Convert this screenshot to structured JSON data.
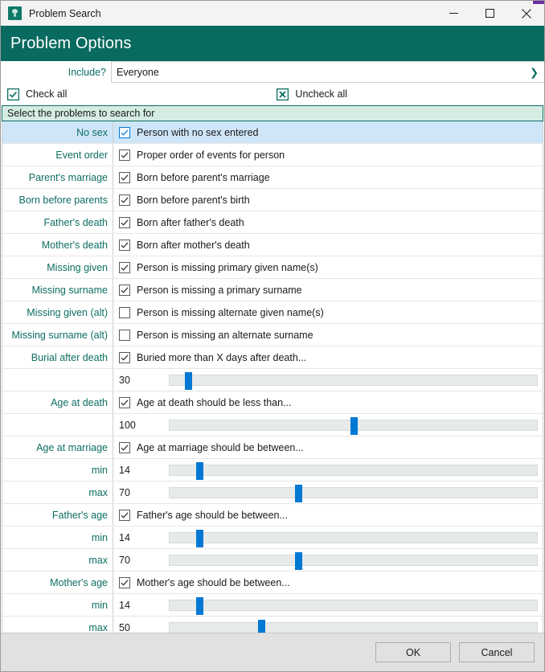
{
  "window": {
    "title": "Problem Search",
    "icon": "tree-icon",
    "controls": {
      "minimize": "minimize-icon",
      "maximize": "maximize-icon",
      "close": "close-icon"
    }
  },
  "banner": {
    "title": "Problem Options",
    "color": "#096a5f"
  },
  "include": {
    "label": "Include?",
    "value": "Everyone",
    "chevron": "chevron-right-icon"
  },
  "bulk": {
    "check_all": "Check all",
    "uncheck_all": "Uncheck all",
    "check_icon": "checkbox-checked-icon",
    "uncheck_icon": "checkbox-x-icon"
  },
  "section": {
    "header": "Select the problems to search for"
  },
  "accent": {
    "teal": "#0d6e62",
    "selection": "#cfe6f9",
    "thumb": "#0078d4"
  },
  "rows": [
    {
      "kind": "check",
      "label": "No sex",
      "text": "Person with no sex entered",
      "checked": true,
      "selected": true
    },
    {
      "kind": "check",
      "label": "Event order",
      "text": "Proper order of events for person",
      "checked": true,
      "selected": false
    },
    {
      "kind": "check",
      "label": "Parent's marriage",
      "text": "Born before parent's marriage",
      "checked": true,
      "selected": false
    },
    {
      "kind": "check",
      "label": "Born before parents",
      "text": "Born before parent's birth",
      "checked": true,
      "selected": false
    },
    {
      "kind": "check",
      "label": "Father's death",
      "text": "Born after father's death",
      "checked": true,
      "selected": false
    },
    {
      "kind": "check",
      "label": "Mother's death",
      "text": "Born after mother's death",
      "checked": true,
      "selected": false
    },
    {
      "kind": "check",
      "label": "Missing given",
      "text": "Person is missing primary given name(s)",
      "checked": true,
      "selected": false
    },
    {
      "kind": "check",
      "label": "Missing surname",
      "text": "Person is missing a primary surname",
      "checked": true,
      "selected": false
    },
    {
      "kind": "check",
      "label": "Missing given (alt)",
      "text": "Person is missing alternate given name(s)",
      "checked": false,
      "selected": false
    },
    {
      "kind": "check",
      "label": "Missing surname (alt)",
      "text": "Person is missing an alternate surname",
      "checked": false,
      "selected": false
    },
    {
      "kind": "check",
      "label": "Burial after death",
      "text": "Buried more than X days after death...",
      "checked": true,
      "selected": false
    },
    {
      "kind": "slider",
      "label": "",
      "value": "30",
      "pct": 5
    },
    {
      "kind": "check",
      "label": "Age at death",
      "text": "Age at death should be less than...",
      "checked": true,
      "selected": false
    },
    {
      "kind": "slider",
      "label": "",
      "value": "100",
      "pct": 50
    },
    {
      "kind": "check",
      "label": "Age at marriage",
      "text": "Age at marriage should be between...",
      "checked": true,
      "selected": false
    },
    {
      "kind": "slider",
      "label": "min",
      "value": "14",
      "pct": 8
    },
    {
      "kind": "slider",
      "label": "max",
      "value": "70",
      "pct": 35
    },
    {
      "kind": "check",
      "label": "Father's age",
      "text": "Father's age should be between...",
      "checked": true,
      "selected": false
    },
    {
      "kind": "slider",
      "label": "min",
      "value": "14",
      "pct": 8
    },
    {
      "kind": "slider",
      "label": "max",
      "value": "70",
      "pct": 35
    },
    {
      "kind": "check",
      "label": "Mother's age",
      "text": "Mother's age should be between...",
      "checked": true,
      "selected": false
    },
    {
      "kind": "slider",
      "label": "min",
      "value": "14",
      "pct": 8
    },
    {
      "kind": "slider",
      "label": "max",
      "value": "50",
      "pct": 25
    }
  ],
  "footer": {
    "ok": "OK",
    "cancel": "Cancel"
  }
}
